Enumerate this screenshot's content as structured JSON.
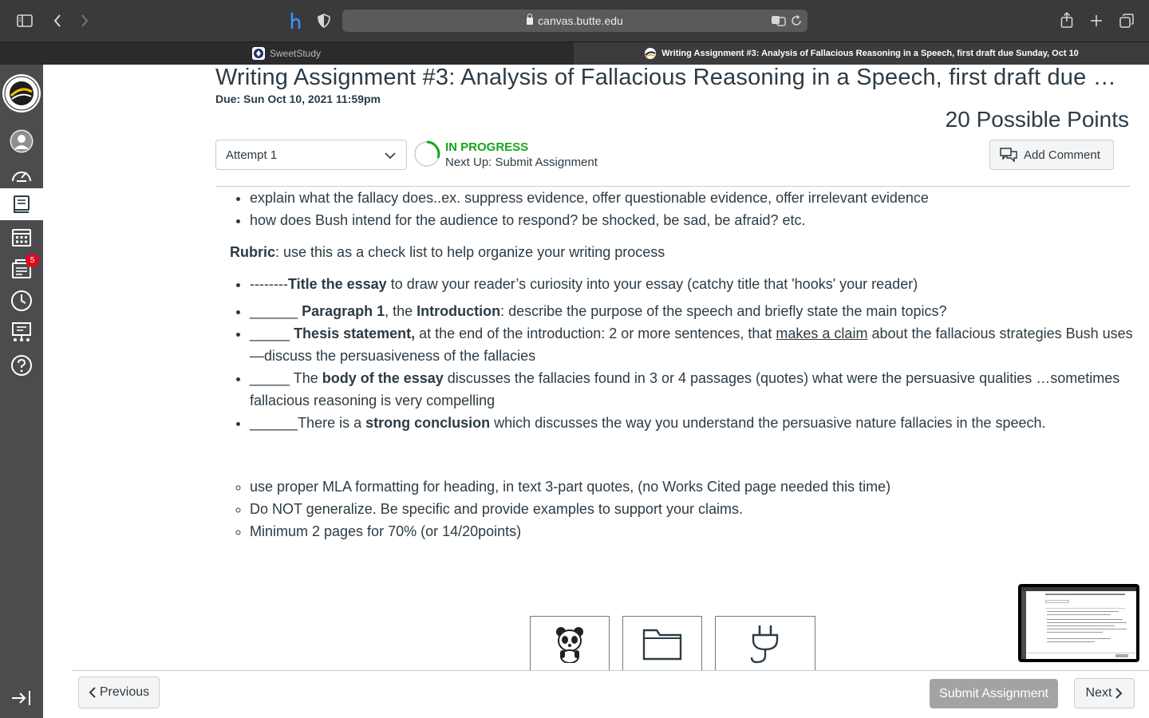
{
  "browser": {
    "url": "canvas.butte.edu",
    "tabs": [
      {
        "label": "SweetStudy"
      },
      {
        "label": "Writing Assignment #3: Analysis of Fallacious Reasoning in a Speech, first draft due Sunday, Oct 10"
      }
    ]
  },
  "nav": {
    "inbox_badge": "5"
  },
  "assignment": {
    "title": "Writing Assignment #3: Analysis of Fallacious Reasoning in a Speech, first draft due Sunday, Oct 10",
    "due": "Due: Sun Oct 10, 2021 11:59pm",
    "points": "20 Possible Points",
    "attempt": "Attempt 1",
    "status": "IN PROGRESS",
    "next_up": "Next Up: Submit Assignment",
    "add_comment": "Add Comment"
  },
  "content": {
    "top_bullets": [
      "explain what the fallacy does..ex. suppress evidence, offer questionable evidence, offer irrelevant evidence",
      "how does Bush intend for the audience to respond? be shocked, be sad, be afraid?  etc."
    ],
    "rubric_label": "Rubric",
    "rubric_text": ": use this as a check list to help organize your writing process",
    "rubric": {
      "r1a": "--------",
      "r1b": "Title the essay",
      "r1c": " to draw your reader’s curiosity into your essay (catchy title that 'hooks' your reader)",
      "r2a": "______ ",
      "r2b": "Paragraph 1",
      "r2c": ", the ",
      "r2d": "Introduction",
      "r2e": ": describe the purpose of the speech and briefly state the main topics?",
      "r3a": "_____  ",
      "r3b": "Thesis statement,",
      "r3c": " at the end of the introduction:  2 or more sentences, that ",
      "r3d": "makes a claim",
      "r3e": " about the fallacious strategies Bush uses—discuss the persuasiveness of the fallacies",
      "r4a": "_____  The ",
      "r4b": "body of the essay",
      "r4c": " discusses the fallacies found in 3 or 4 passages (quotes) what were the persuasive qualities …sometimes fallacious reasoning is very compelling",
      "r5a": "______There is a ",
      "r5b": "strong conclusion",
      "r5c": " which discusses the way you understand the persuasive nature fallacies in the speech."
    },
    "sub_bullets": [
      "use proper MLA formatting for heading, in text 3-part quotes, (no Works Cited page needed this time)",
      "Do NOT generalize. Be specific and provide examples to support your claims.",
      "Minimum 2 pages for 70% (or 14/20points)"
    ]
  },
  "footer": {
    "previous": "Previous",
    "submit": "Submit Assignment",
    "next": "Next"
  },
  "colors": {
    "status_green": "#14a61b",
    "badge_red": "#e0061f",
    "nav_bg": "#4c4c4f"
  }
}
